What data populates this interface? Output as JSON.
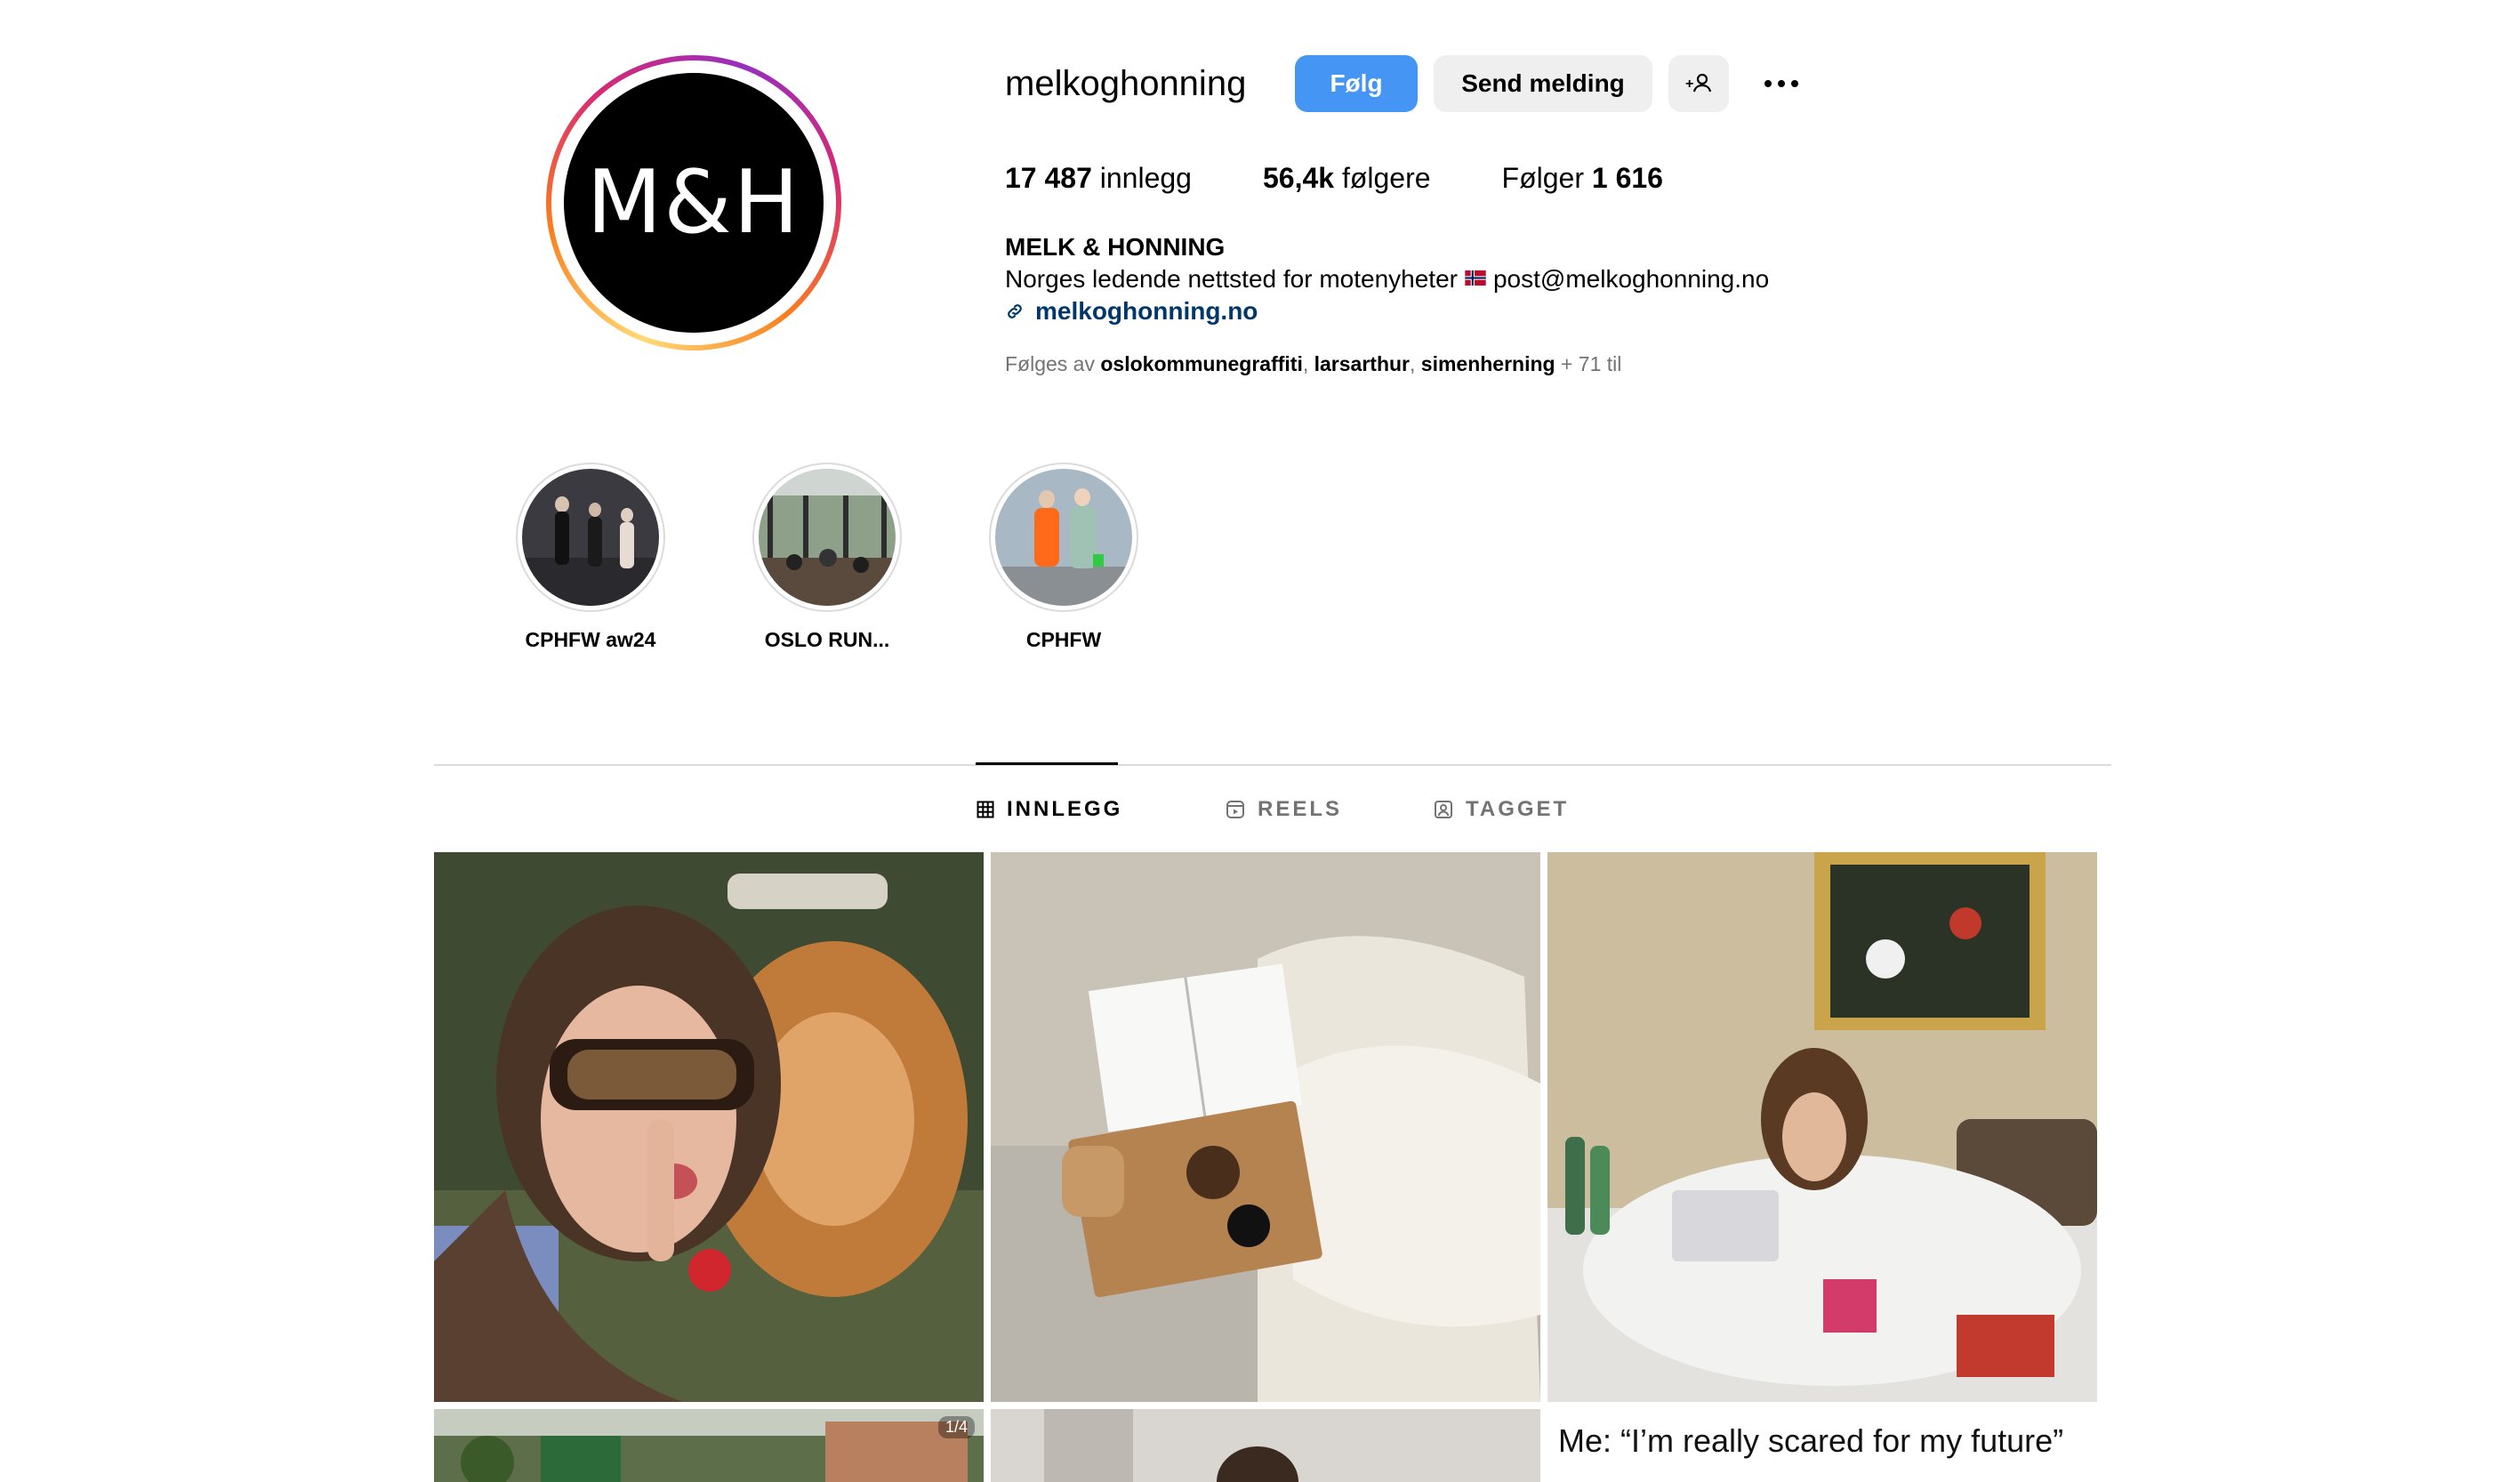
{
  "profile": {
    "avatar_text": "M&H",
    "username": "melkoghonning",
    "follow_label": "Følg",
    "message_label": "Send melding",
    "add_user_icon": "person-plus-icon",
    "more_icon": "ellipsis-icon",
    "posts_count": "17 487",
    "posts_label": "innlegg",
    "followers_count": "56,4k",
    "followers_label": "følgere",
    "following_label": "Følger",
    "following_count": "1 616",
    "full_name": "MELK & HONNING",
    "bio_text": "Norges ledende nettsted for motenyheter",
    "bio_flag": "norway-flag-icon",
    "bio_email": "post@melkoghonning.no",
    "website": "melkoghonning.no",
    "followed_by_prefix": "Følges av",
    "followed_by": [
      "oslokommunegraffiti",
      "larsarthur",
      "simenherning"
    ],
    "followed_by_more": "+ 71 til"
  },
  "highlights": [
    {
      "label": "CPHFW aw24"
    },
    {
      "label": "OSLO RUN..."
    },
    {
      "label": "CPHFW"
    }
  ],
  "tabs": [
    {
      "label": "INNLEGG",
      "icon": "grid-icon",
      "active": true
    },
    {
      "label": "REELS",
      "icon": "reels-icon",
      "active": false
    },
    {
      "label": "TAGGET",
      "icon": "tagged-icon",
      "active": false
    }
  ],
  "grid": {
    "carousel_badge": "1/4",
    "caption_text": "Me: “I’m really scared for my future”"
  },
  "colors": {
    "follow_button": "#4495f4",
    "link": "#00376b",
    "secondary_text": "#737373"
  }
}
